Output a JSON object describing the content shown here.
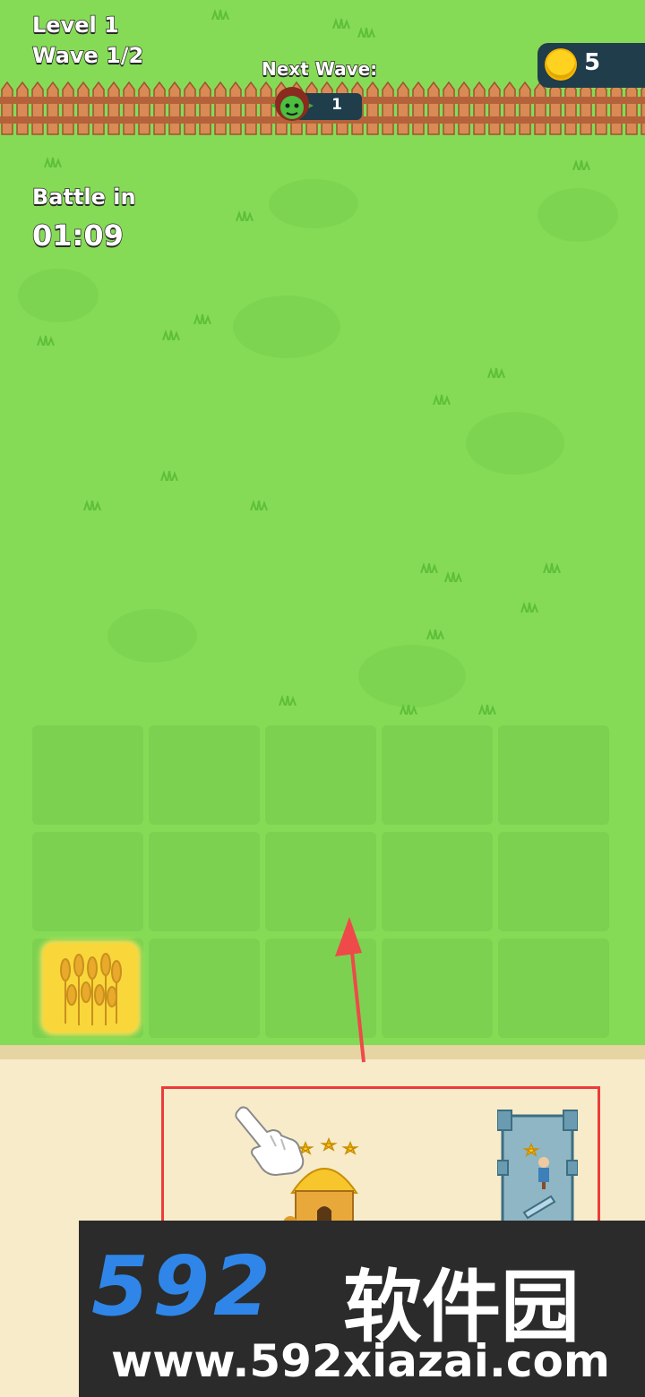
{
  "hud": {
    "level": "Level 1",
    "wave": "Wave 1/2",
    "next_wave_label": "Next Wave:",
    "next_wave_enemies": "1",
    "coins": "5",
    "battle_label": "Battle in",
    "battle_timer": "01:09"
  },
  "board": {
    "rows": 3,
    "cols": 5,
    "occupied": [
      {
        "row": 3,
        "col": 1,
        "item": "wheat-field"
      }
    ]
  },
  "tray": {
    "items": [
      {
        "name": "hut",
        "stars": 3
      },
      {
        "name": "castle-barracks",
        "stars": 1
      }
    ]
  },
  "tutorial": {
    "hint": "drag-up-arrow",
    "pointer": "pointing-hand-icon"
  },
  "watermark": {
    "brand": "592",
    "brand_cn": "软件园",
    "url": "www.592xiazai.com"
  },
  "colors": {
    "grass": "#86db56",
    "ground": "#f7ebc9",
    "tray_border": "#ee3a3a",
    "hud_panel": "#1f3d4a",
    "coin": "#ffd21f",
    "watermark_blue": "#2f86e8"
  }
}
